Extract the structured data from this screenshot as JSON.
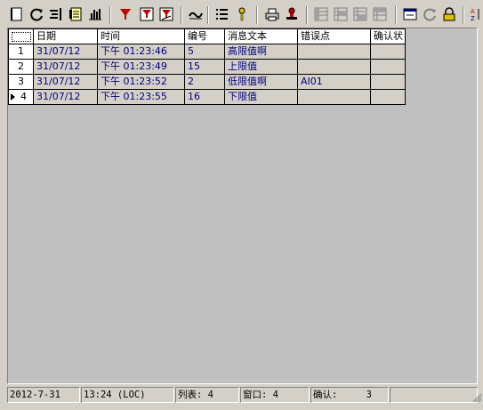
{
  "toolbar": {
    "buttons": [
      "new-list-icon",
      "refresh-icon",
      "indent-icon",
      "notes-icon",
      "bar-chart-icon",
      "filter-icon",
      "filter-check-icon",
      "filter-edit-icon",
      "wave-icon",
      "list-icon",
      "key-icon",
      "print-icon",
      "stamp-icon",
      "grid1-icon",
      "grid2-icon",
      "grid3-icon",
      "grid4-icon",
      "window-icon",
      "reload-icon",
      "lock-icon",
      "sort-az-icon"
    ]
  },
  "table": {
    "columns": [
      "日期",
      "时间",
      "编号",
      "消息文本",
      "错误点",
      "确认状"
    ],
    "rows": [
      {
        "num": "1",
        "date": "31/07/12",
        "time": "下午 01:23:46",
        "id": "5",
        "text": "高限值啊",
        "err": "",
        "ack": ""
      },
      {
        "num": "2",
        "date": "31/07/12",
        "time": "下午 01:23:49",
        "id": "15",
        "text": "上限值",
        "err": "",
        "ack": ""
      },
      {
        "num": "3",
        "date": "31/07/12",
        "time": "下午 01:23:52",
        "id": "2",
        "text": "低限值啊",
        "err": "AI01",
        "ack": ""
      },
      {
        "num": "4",
        "date": "31/07/12",
        "time": "下午 01:23:55",
        "id": "16",
        "text": "下限值",
        "err": "",
        "ack": ""
      }
    ],
    "current_row_indicator": "▶"
  },
  "status": {
    "date": "2012-7-31",
    "time": "13:24 (LOC)",
    "list": "列表:  4",
    "window": "窗口:  4",
    "ack_label": "确认:",
    "ack_value": "3",
    "extra": ""
  },
  "colors": {
    "data_text": "#000080",
    "face": "#d4d0c8",
    "pane": "#c0c0c0"
  }
}
